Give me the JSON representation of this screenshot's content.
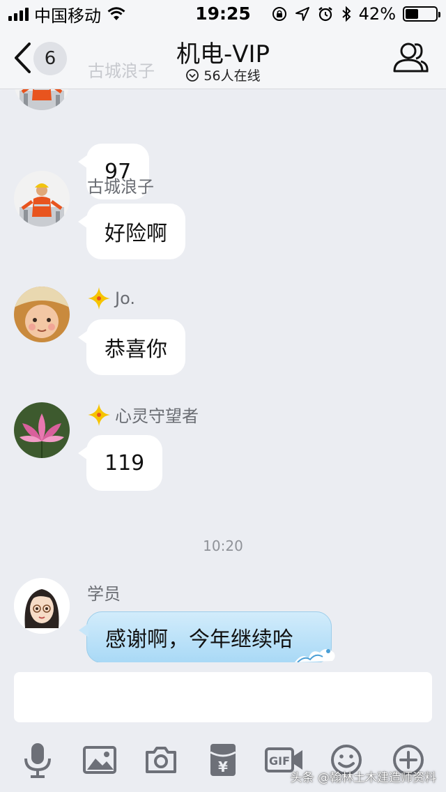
{
  "status_bar": {
    "carrier": "中国移动",
    "time": "19:25",
    "battery_percent": "42%",
    "battery_level": 0.42,
    "icons": [
      "signal-icon",
      "wifi-icon",
      "rotation-lock-icon",
      "location-icon",
      "alarm-icon",
      "bluetooth-icon",
      "battery-icon"
    ]
  },
  "header": {
    "unread_count": "6",
    "behind_name": "古城浪子",
    "title": "机电-VIP",
    "online_status": "56人在线",
    "icons": [
      "back-chevron-icon",
      "dropdown-circle-icon",
      "group-members-icon"
    ]
  },
  "messages": [
    {
      "sender": "",
      "text": "97",
      "avatar": "worker"
    },
    {
      "sender": "古城浪子",
      "text": "好险啊",
      "avatar": "worker"
    },
    {
      "sender": "Jo.",
      "text": "恭喜你",
      "avatar": "baby",
      "vip_badge": true
    },
    {
      "sender": "心灵守望者",
      "text": "119",
      "avatar": "lotus",
      "vip_badge": true
    },
    {
      "sender": "学员",
      "text": "感谢啊，今年继续哈",
      "avatar": "girl",
      "bubble_style": "blue"
    }
  ],
  "time_separator": "10:20",
  "input": {
    "value": ""
  },
  "toolbar": {
    "items": [
      "microphone-icon",
      "image-icon",
      "camera-icon",
      "red-packet-icon",
      "gif-icon",
      "emoji-icon",
      "plus-icon"
    ],
    "red_packet_symbol": "¥",
    "gif_label": "GIF"
  },
  "watermark": "头条 @翰林土木建造师资料",
  "colors": {
    "background": "#ebedf2",
    "bubble": "#ffffff",
    "blue_bubble": "#b9e0f8",
    "vip_star": "#f6c400"
  }
}
